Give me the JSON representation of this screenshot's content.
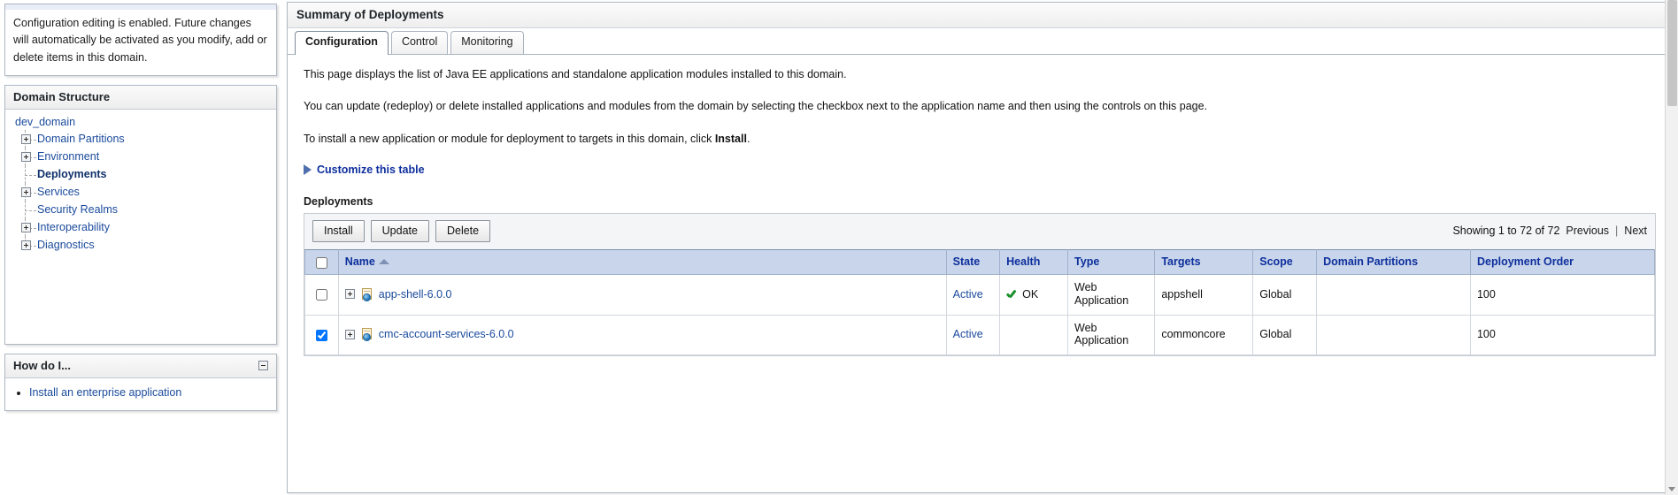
{
  "change_center": {
    "notice": "Configuration editing is enabled. Future changes will automatically be activated as you modify, add or delete items in this domain."
  },
  "domain_structure": {
    "title": "Domain Structure",
    "root": "dev_domain",
    "items": [
      {
        "label": "Domain Partitions",
        "expandable": true,
        "current": false
      },
      {
        "label": "Environment",
        "expandable": true,
        "current": false
      },
      {
        "label": "Deployments",
        "expandable": false,
        "current": true
      },
      {
        "label": "Services",
        "expandable": true,
        "current": false
      },
      {
        "label": "Security Realms",
        "expandable": false,
        "current": false
      },
      {
        "label": "Interoperability",
        "expandable": true,
        "current": false
      },
      {
        "label": "Diagnostics",
        "expandable": true,
        "current": false
      }
    ]
  },
  "how_do_i": {
    "title": "How do I...",
    "links": [
      "Install an enterprise application"
    ]
  },
  "main": {
    "title": "Summary of Deployments",
    "tabs": [
      {
        "label": "Configuration",
        "active": true
      },
      {
        "label": "Control",
        "active": false
      },
      {
        "label": "Monitoring",
        "active": false
      }
    ],
    "paragraphs": [
      "This page displays the list of Java EE applications and standalone application modules installed to this domain.",
      "You can update (redeploy) or delete installed applications and modules from the domain by selecting the checkbox next to the application name and then using the controls on this page."
    ],
    "install_sentence_before": "To install a new application or module for deployment to targets in this domain, click ",
    "install_sentence_bold": "Install",
    "install_sentence_after": ".",
    "customize_link": "Customize this table",
    "table_title": "Deployments",
    "buttons": {
      "install": "Install",
      "update": "Update",
      "delete": "Delete"
    },
    "pager": {
      "showing": "Showing 1 to 72 of 72",
      "previous": "Previous",
      "separator": "|",
      "next": "Next"
    },
    "table": {
      "columns": [
        "Name",
        "State",
        "Health",
        "Type",
        "Targets",
        "Scope",
        "Domain Partitions",
        "Deployment Order"
      ],
      "sort_column": "Name",
      "sort_direction": "ascending",
      "rows": [
        {
          "selected": false,
          "name": "app-shell-6.0.0",
          "state": "Active",
          "health": "OK",
          "health_ok": true,
          "type": "Web Application",
          "targets": "appshell",
          "scope": "Global",
          "domain_partitions": "",
          "deployment_order": "100"
        },
        {
          "selected": true,
          "name": "cmc-account-services-6.0.0",
          "state": "Active",
          "health": "",
          "health_ok": false,
          "type": "Web Application",
          "targets": "commoncore",
          "scope": "Global",
          "domain_partitions": "",
          "deployment_order": "100"
        }
      ]
    }
  },
  "colors": {
    "link": "#1a4a9c",
    "header_blue": "#c9d5ea",
    "header_text": "#0d2f9d",
    "health_ok": "#1a8f2a"
  }
}
